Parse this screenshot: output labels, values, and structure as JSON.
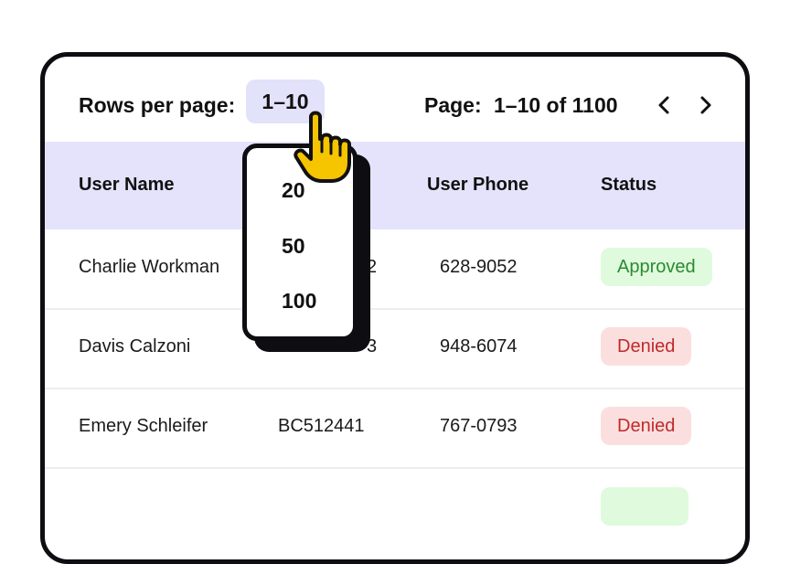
{
  "pagination": {
    "rows_label": "Rows per page:",
    "rows_value": "1–10",
    "page_label": "Page:",
    "page_range": "1–10 of 1100",
    "prev_icon": "chevron-left-icon",
    "next_icon": "chevron-right-icon"
  },
  "dropdown": {
    "options": [
      "20",
      "50",
      "100"
    ]
  },
  "table": {
    "columns": [
      "User Name",
      "User Phone",
      "Status"
    ],
    "rows": [
      {
        "name": "Charlie Workman",
        "id": "2",
        "phone": "628-9052",
        "status": "Approved"
      },
      {
        "name": "Davis Calzoni",
        "id": "3",
        "phone": "948-6074",
        "status": "Denied"
      },
      {
        "name": "Emery Schleifer",
        "id": "BC512441",
        "phone": "767-0793",
        "status": "Denied"
      }
    ]
  },
  "colors": {
    "header_bg": "#e4e3fb",
    "approved_bg": "#dffadc",
    "approved_text": "#2b8a32",
    "denied_bg": "#fbdfdf",
    "denied_text": "#c02b2b",
    "cursor": "#f7c400"
  }
}
